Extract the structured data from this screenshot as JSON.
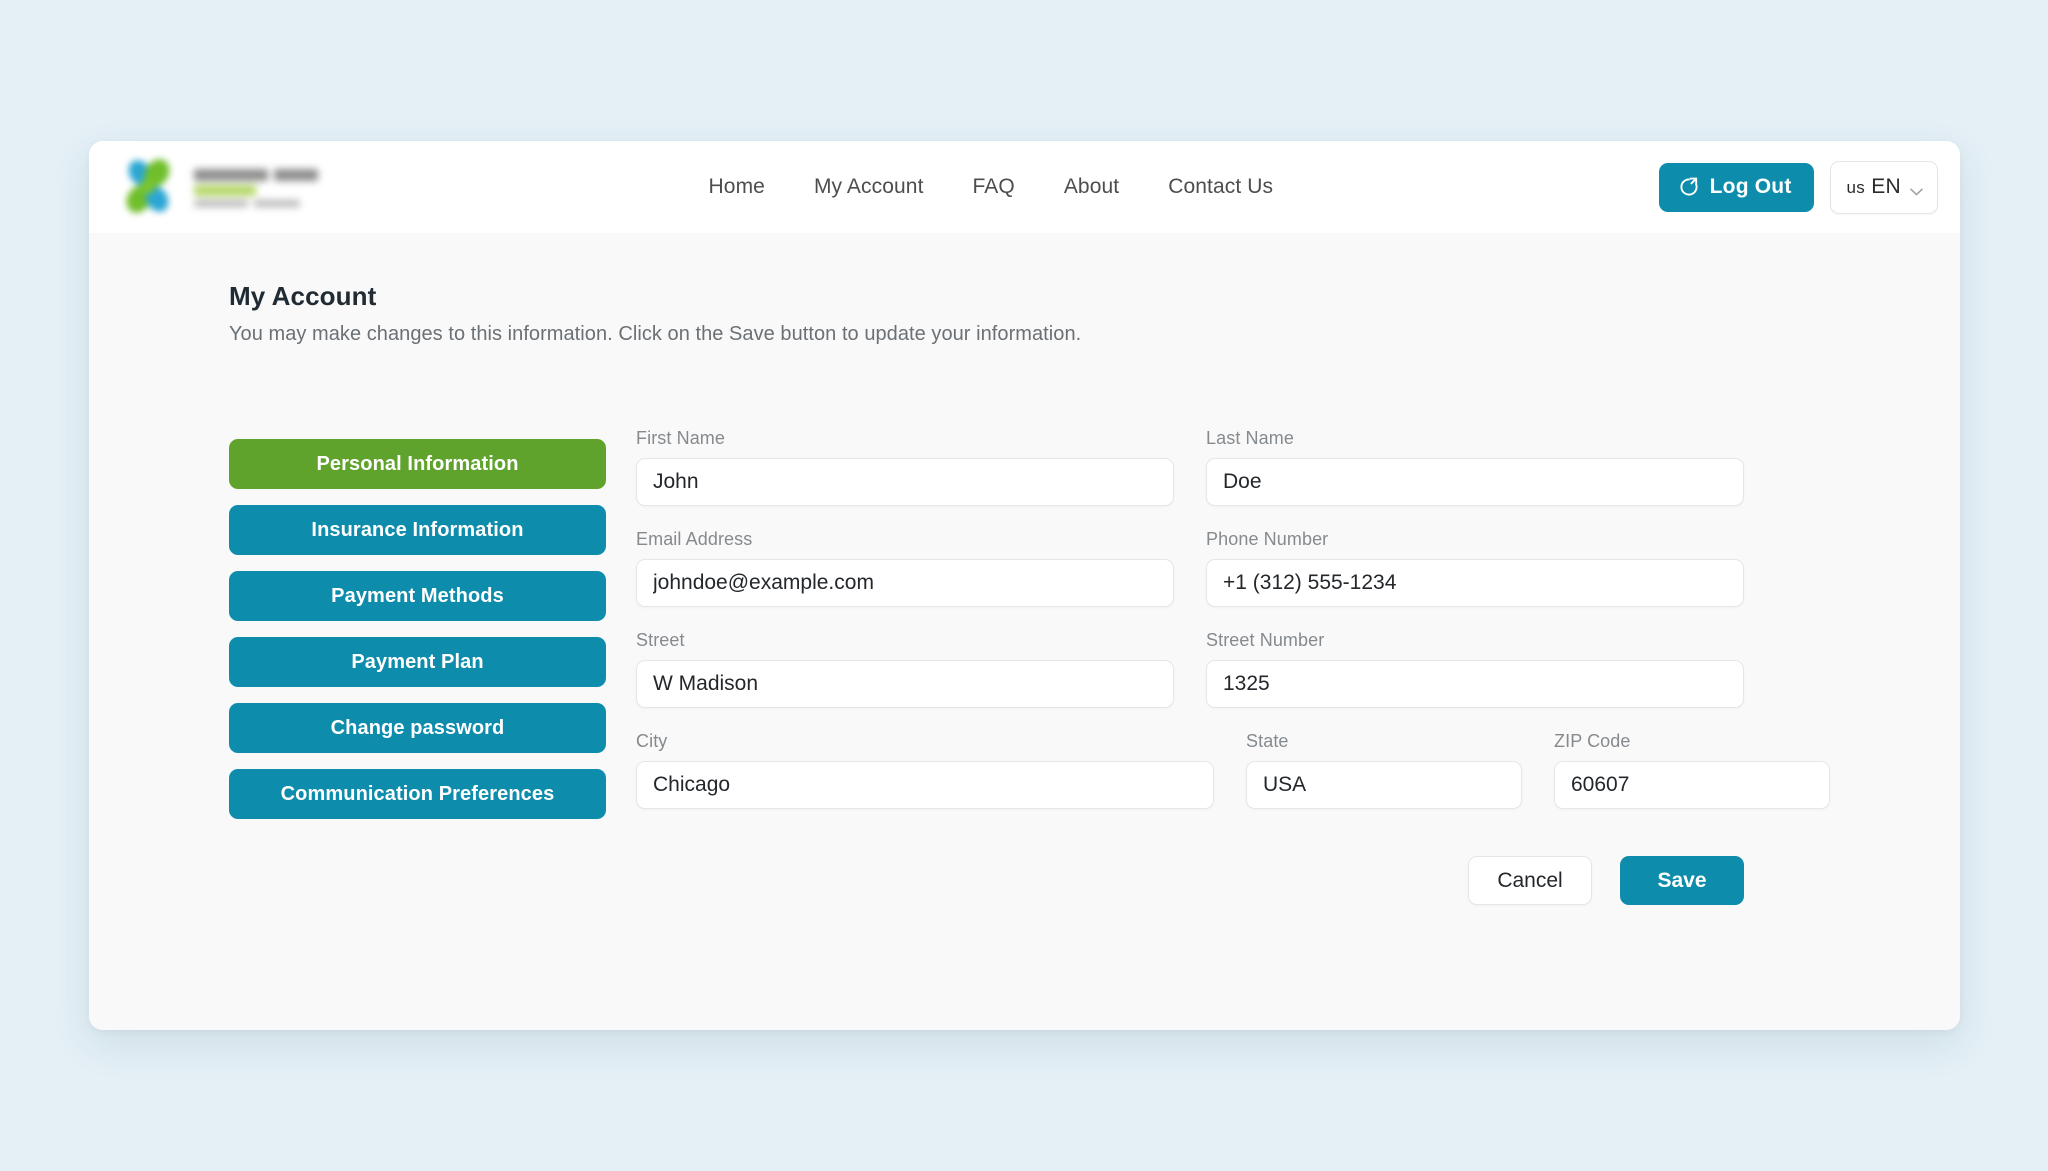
{
  "theme": {
    "page_background": "#e4f0f6",
    "accent_teal": "#0e8cac",
    "accent_green": "#60a32c",
    "surface": "#f9f9f9",
    "header_surface": "#ffffff",
    "text_primary": "#202b33",
    "text_muted": "#858a8f"
  },
  "header": {
    "brand": {
      "logo_icon": "butterfly-pinwheel-logo",
      "wordmark_redacted": true
    },
    "nav": [
      {
        "label": "Home",
        "name": "nav-home"
      },
      {
        "label": "My Account",
        "name": "nav-my-account"
      },
      {
        "label": "FAQ",
        "name": "nav-faq"
      },
      {
        "label": "About",
        "name": "nav-about"
      },
      {
        "label": "Contact Us",
        "name": "nav-contact-us"
      }
    ],
    "logout": {
      "label": "Log Out",
      "icon": "logout-icon"
    },
    "language": {
      "region": "us",
      "code": "EN",
      "icon": "chevron-down-icon"
    }
  },
  "page": {
    "title": "My Account",
    "subtitle": "You may make changes to this information. Click on the Save button to update your information."
  },
  "account_nav": {
    "active_index": 0,
    "items": [
      {
        "label": "Personal Information",
        "active": true
      },
      {
        "label": "Insurance Information",
        "active": false
      },
      {
        "label": "Payment Methods",
        "active": false
      },
      {
        "label": "Payment Plan",
        "active": false
      },
      {
        "label": "Change password",
        "active": false
      },
      {
        "label": "Communication Preferences",
        "active": false
      }
    ]
  },
  "form": {
    "first_name": {
      "label": "First Name",
      "value": "John",
      "placeholder": "First Name"
    },
    "last_name": {
      "label": "Last Name",
      "value": "Doe",
      "placeholder": "Last Name"
    },
    "email": {
      "label": "Email Address",
      "value": "johndoe@example.com",
      "placeholder": "Email Address"
    },
    "phone": {
      "label": "Phone Number",
      "value": "+1 (312) 555-1234",
      "placeholder": "Phone Number"
    },
    "street": {
      "label": "Street",
      "value": "W Madison",
      "placeholder": "Street"
    },
    "street_number": {
      "label": "Street Number",
      "value": "1325",
      "placeholder": "Street Number"
    },
    "city": {
      "label": "City",
      "value": "Chicago",
      "placeholder": "City"
    },
    "state": {
      "label": "State",
      "value": "USA",
      "placeholder": "State"
    },
    "zip": {
      "label": "ZIP Code",
      "value": "60607",
      "placeholder": "ZIP Code"
    },
    "actions": {
      "cancel_label": "Cancel",
      "save_label": "Save"
    }
  }
}
